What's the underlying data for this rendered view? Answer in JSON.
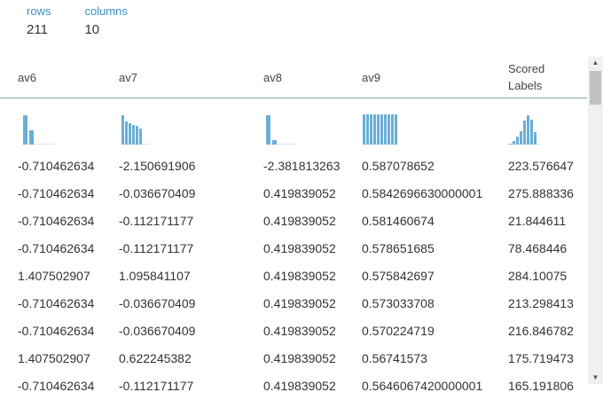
{
  "summary": {
    "rows_label": "rows",
    "rows_value": "211",
    "columns_label": "columns",
    "columns_value": "10"
  },
  "columns": [
    {
      "id": "av6",
      "label": "av6"
    },
    {
      "id": "av7",
      "label": "av7"
    },
    {
      "id": "av8",
      "label": "av8"
    },
    {
      "id": "av9",
      "label": "av9"
    },
    {
      "id": "scored",
      "label": "Scored\nLabels"
    }
  ],
  "histograms": [
    [
      0.93,
      0.45,
      0.0,
      0.0,
      0.0
    ],
    [
      0.93,
      0.75,
      0.68,
      0.63,
      0.6,
      0.5,
      0.0,
      0.0
    ],
    [
      0.95,
      0.15,
      0.0,
      0.0,
      0.0
    ],
    [
      0.97,
      0.97,
      0.97,
      0.97,
      0.97,
      0.97,
      0.97,
      0.97,
      0.97,
      0.97
    ],
    [
      0.03,
      0.1,
      0.27,
      0.43,
      0.77,
      0.93,
      0.8,
      0.4,
      0.0
    ]
  ],
  "rows": [
    [
      "-0.710462634",
      "-2.150691906",
      "-2.381813263",
      "0.587078652",
      "223.576647"
    ],
    [
      "-0.710462634",
      "-0.036670409",
      "0.419839052",
      "0.5842696630000001",
      "275.888336"
    ],
    [
      "-0.710462634",
      "-0.112171177",
      "0.419839052",
      "0.581460674",
      "21.844611"
    ],
    [
      "-0.710462634",
      "-0.112171177",
      "0.419839052",
      "0.578651685",
      "78.468446"
    ],
    [
      "1.407502907",
      "1.095841107",
      "0.419839052",
      "0.575842697",
      "284.10075"
    ],
    [
      "-0.710462634",
      "-0.036670409",
      "0.419839052",
      "0.573033708",
      "213.298413"
    ],
    [
      "-0.710462634",
      "-0.036670409",
      "0.419839052",
      "0.570224719",
      "216.846782"
    ],
    [
      "1.407502907",
      "0.622245382",
      "0.419839052",
      "0.56741573",
      "175.719473"
    ],
    [
      "-0.710462634",
      "-0.112171177",
      "0.419839052",
      "0.5646067420000001",
      "165.191806"
    ]
  ],
  "colors": {
    "accent": "#3a8fc7",
    "histogram_bar": "#6aaed6",
    "divider": "#8aa3b3"
  },
  "icons": {
    "scroll_up": "scroll-up-arrow-icon",
    "scroll_down": "scroll-down-arrow-icon"
  }
}
